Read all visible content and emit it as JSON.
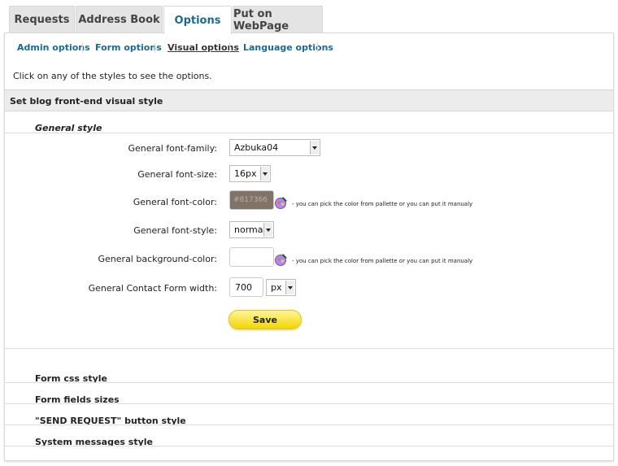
{
  "tabs": [
    {
      "label": "Requests"
    },
    {
      "label": "Address Book"
    },
    {
      "label": "Options"
    },
    {
      "label": "Put on WebPage"
    }
  ],
  "active_tab": "Options",
  "subnav": [
    {
      "label": "Admin options"
    },
    {
      "label": "Form options"
    },
    {
      "label": "Visual options"
    },
    {
      "label": "Language options"
    }
  ],
  "hint": "Click on any of the styles to see the options.",
  "section_title": "Set blog front-end visual style",
  "general": {
    "title": "General style",
    "font_family_label": "General font-family:",
    "font_family_value": "Azbuka04",
    "font_size_label": "General font-size:",
    "font_size_value": "16px",
    "font_color_label": "General font-color:",
    "font_color_value": "#817366",
    "font_color_swatch": "#817366",
    "picker_note": "- you can pick the color from pallette or you can put it manualy",
    "font_style_label": "General font-style:",
    "font_style_value": "normal",
    "bg_color_label": "General background-color:",
    "bg_color_value": "",
    "width_label": "General Contact Form width:",
    "width_value": "700",
    "width_unit": "px",
    "save_label": "Save"
  },
  "collapsed_groups": [
    {
      "label": "Form css style"
    },
    {
      "label": "Form fields sizes"
    },
    {
      "label": "\"SEND REQUEST\" button style"
    },
    {
      "label": "System messages style"
    }
  ],
  "colors": {
    "accent": "#1a6a92",
    "save_button": "#f8e44a"
  }
}
